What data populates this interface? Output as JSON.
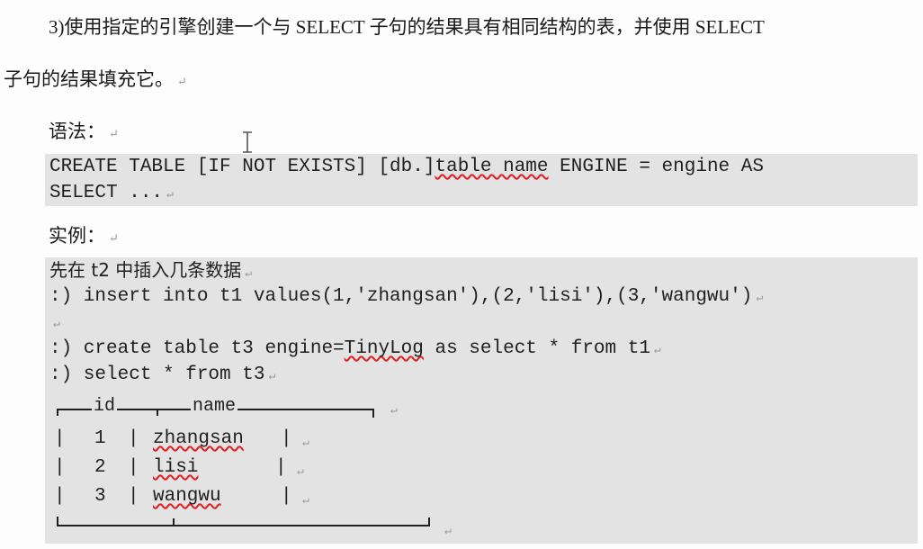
{
  "heading": {
    "line1": "3)使用指定的引擎创建一个与 SELECT 子句的结果具有相同结构的表，并使用 SELECT",
    "line2": "子句的结果填充它。"
  },
  "syntax": {
    "label": "语法：",
    "code_line1_a": "CREATE TABLE [IF NOT EXISTS] [db.]",
    "code_line1_squig": "table name",
    "code_line1_b": " ENGINE = engine AS",
    "code_line2": "SELECT ..."
  },
  "example": {
    "label": "实例：",
    "intro": "先在 t2 中插入几条数据",
    "insert": ":) insert into t1 values(1,'zhangsan'),(2,'lisi'),(3,'wangwu')",
    "create_a": ":) create table t3 engine=",
    "create_squig": "TinyLog",
    "create_b": " as select * from t1",
    "select": ":) select * from t3"
  },
  "result": {
    "columns": [
      "id",
      "name"
    ],
    "rows": [
      {
        "id": "1",
        "name": "zhangsan"
      },
      {
        "id": "2",
        "name": "lisi"
      },
      {
        "id": "3",
        "name": "wangwu"
      }
    ]
  },
  "para_mark": "↵",
  "icons": {
    "cursor": "i-beam-cursor-icon"
  }
}
